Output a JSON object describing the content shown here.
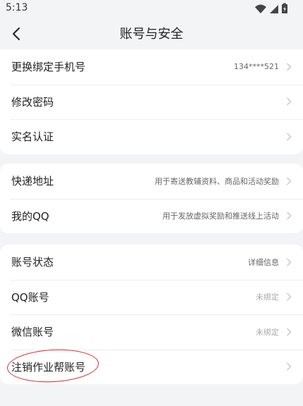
{
  "status_bar": {
    "time": "5:13"
  },
  "header": {
    "title": "账号与安全"
  },
  "groups": [
    {
      "items": [
        {
          "label": "更换绑定手机号",
          "value": "134****521"
        },
        {
          "label": "修改密码",
          "value": ""
        },
        {
          "label": "实名认证",
          "value": ""
        }
      ]
    },
    {
      "items": [
        {
          "label": "快递地址",
          "value": "用于寄送教辅资料、商品和活动奖励"
        },
        {
          "label": "我的QQ",
          "value": "用于发放虚拟奖励和推送线上活动"
        }
      ]
    },
    {
      "items": [
        {
          "label": "账号状态",
          "value": "详细信息"
        },
        {
          "label": "QQ账号",
          "value": "未绑定"
        },
        {
          "label": "微信账号",
          "value": "未绑定"
        },
        {
          "label": "注销作业帮账号",
          "value": ""
        }
      ]
    }
  ],
  "colors": {
    "annotation": "#d9262b",
    "background": "#f3f4f6"
  },
  "icons": [
    "wifi-icon",
    "signal-icon",
    "battery-icon",
    "back-arrow-icon",
    "chevron-right-icon"
  ]
}
